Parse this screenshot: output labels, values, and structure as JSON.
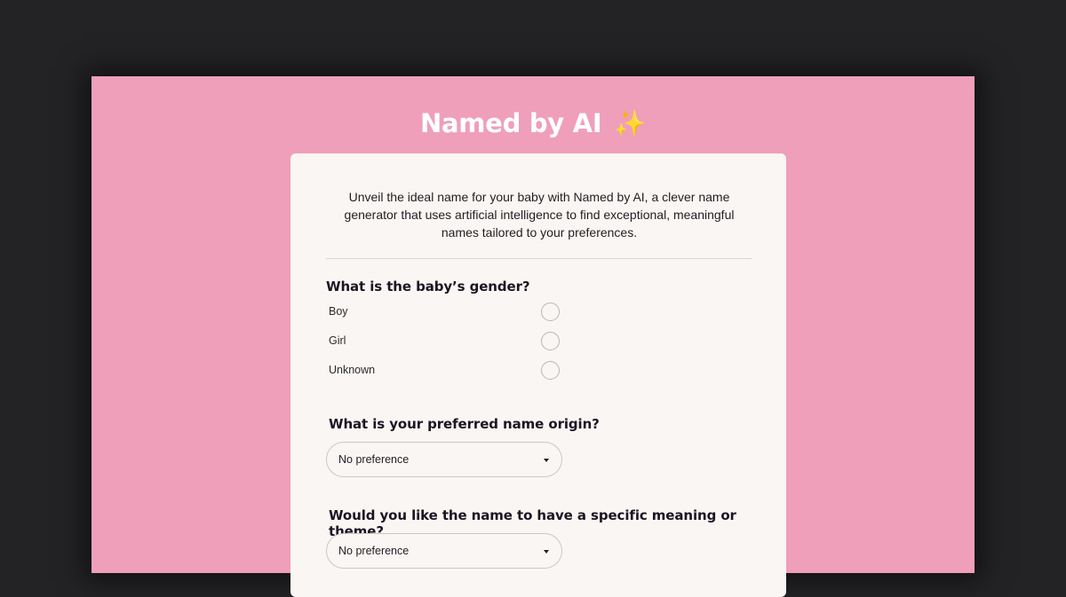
{
  "header": {
    "title": "Named by AI",
    "sparkle": "✨"
  },
  "intro": {
    "text": "Unveil the ideal name for your baby with Named by AI, a clever name generator that uses artificial intelligence to find exceptional, meaningful names tailored to your preferences."
  },
  "gender": {
    "question": "What is the baby’s gender?",
    "options": [
      {
        "label": "Boy",
        "selected": false
      },
      {
        "label": "Girl",
        "selected": false
      },
      {
        "label": "Unknown",
        "selected": false
      }
    ]
  },
  "origin": {
    "question": "What is your preferred name origin?",
    "selected": "No preference"
  },
  "meaning": {
    "question": "Would you like the name to have a specific meaning or theme?",
    "selected": "No preference"
  },
  "colors": {
    "background": "#232326",
    "brand_pink": "#ef9fba",
    "card": "#faf6f3",
    "heading_text": "#1b1523"
  }
}
